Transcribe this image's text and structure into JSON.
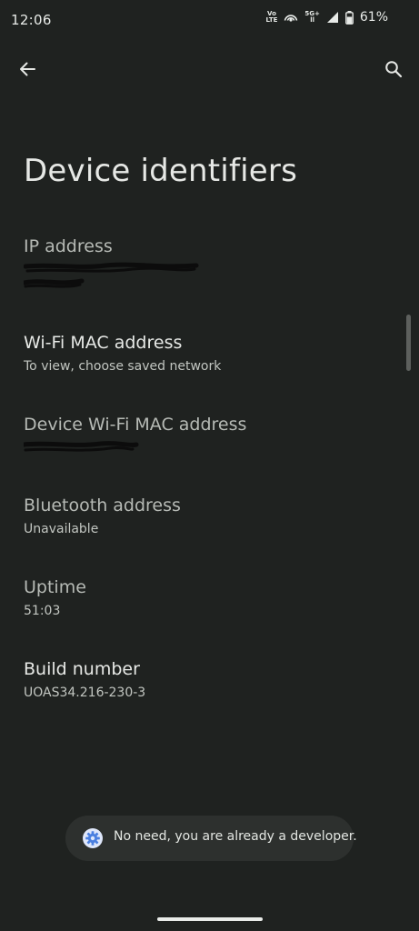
{
  "status_bar": {
    "time": "12:06",
    "volte_top": "Vo",
    "volte_bottom": "LTE",
    "network_top": "5G+",
    "network_bottom": "ll",
    "battery": "61%"
  },
  "page": {
    "title": "Device identifiers"
  },
  "items": [
    {
      "title": "IP address",
      "summary": "",
      "redacted": true
    },
    {
      "title": "Wi-Fi MAC address",
      "summary": "To view, choose saved network"
    },
    {
      "title": "Device Wi-Fi MAC address",
      "summary": "",
      "redacted": true
    },
    {
      "title": "Bluetooth address",
      "summary": "Unavailable"
    },
    {
      "title": "Uptime",
      "summary": "51:03"
    },
    {
      "title": "Build number",
      "summary": "UOAS34.216-230-3"
    }
  ],
  "toast": {
    "message": "No need, you are already a developer."
  },
  "colors": {
    "background": "#1f2220",
    "toast_bg": "#2d302e",
    "toast_icon": "#4a7fe0"
  }
}
